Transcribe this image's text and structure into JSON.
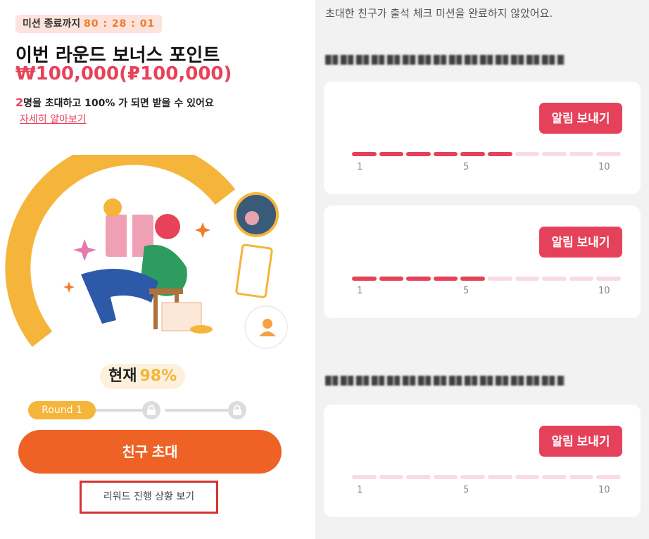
{
  "left": {
    "badge_label": "미션 종료까지",
    "badge_time": "80 : 28 : 01",
    "title": "이번 라운드 보너스 포인트",
    "bonus": "₩100,000(₽100,000)",
    "desc_num": "2",
    "desc_text": "명을 초대하고 100% 가 되면 받을 수 있어요",
    "learn_more": "자세히 알아보기",
    "current_label": "현재",
    "current_pct": "98%",
    "round_label": "Round 1",
    "invite_button": "친구 초대",
    "reward_link": "리워드 진행 상황 보기",
    "colors": {
      "accent": "#ee6226",
      "red": "#e8425a",
      "yellow": "#f5b53a"
    }
  },
  "right": {
    "top_note": "초대한 친구가 출석 체크 미션을 완료하지 않았어요.",
    "cards": [
      {
        "button": "알림 보내기",
        "progress_of_10": 6,
        "ticks": [
          "1",
          "5",
          "10"
        ]
      },
      {
        "button": "알림 보내기",
        "progress_of_10": 5,
        "ticks": [
          "1",
          "5",
          "10"
        ]
      },
      {
        "button": "알림 보내기",
        "progress_of_10": 0,
        "ticks": [
          "1",
          "5",
          "10"
        ]
      }
    ]
  }
}
